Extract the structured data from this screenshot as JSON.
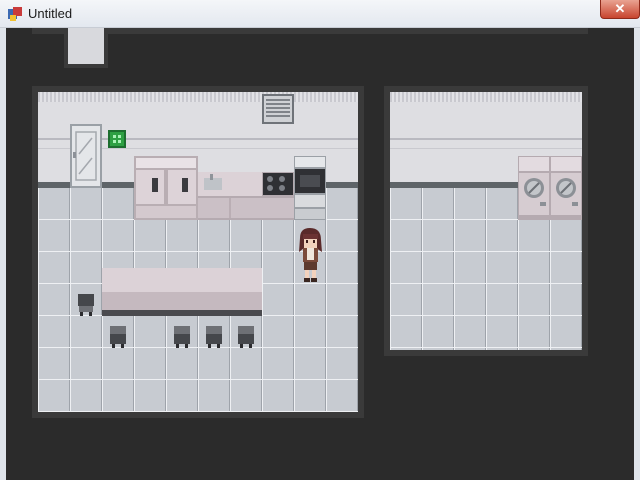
{
  "window": {
    "title": "Untitled",
    "close_glyph": "✕"
  },
  "colors": {
    "void": "#2b2b2b",
    "wall": "#dedee2",
    "floor": "#c7cbd1",
    "hair": "#5a2a2a",
    "vent": "#7f8389",
    "sign": "#2ea043"
  },
  "icons": {
    "app": "rpg-maker-icon",
    "close": "close-icon"
  },
  "rooms": [
    "kitchen",
    "laundry"
  ],
  "chairs_count": 5,
  "washers_count": 2
}
